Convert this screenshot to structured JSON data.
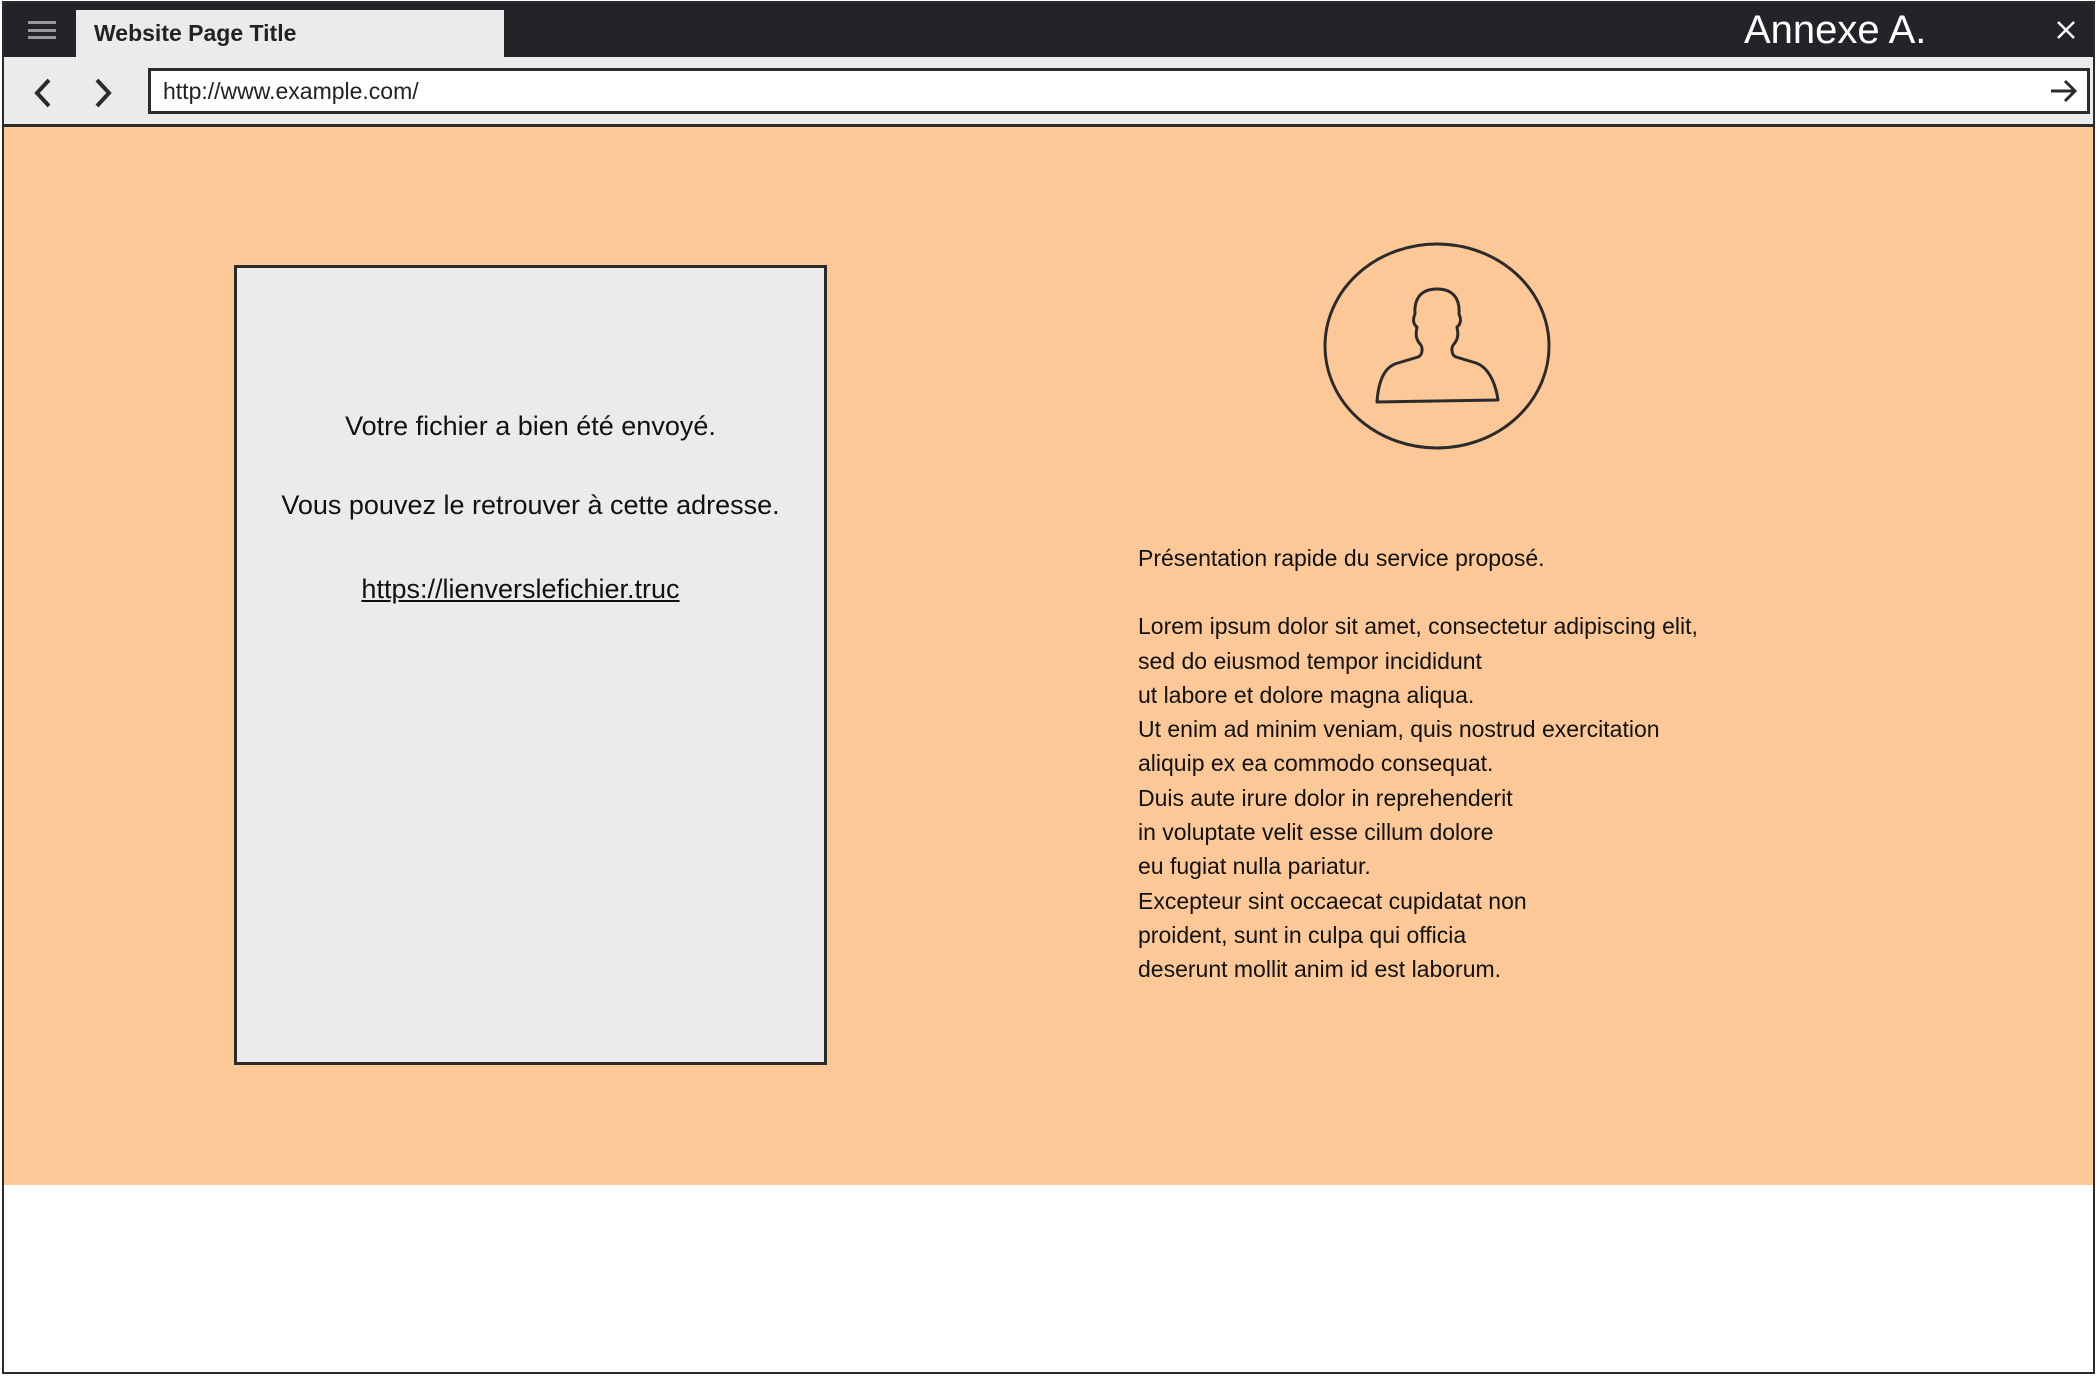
{
  "browser": {
    "tab_title": "Website Page Title",
    "annex_label": "Annexe A.",
    "url": "http://www.example.com/"
  },
  "icons": {
    "menu": "hamburger-menu-icon",
    "close": "close-icon",
    "back": "chevron-left-icon",
    "forward": "chevron-right-icon",
    "go": "arrow-right-icon",
    "avatar": "user-avatar-icon"
  },
  "colors": {
    "titlebar": "#232427",
    "content_background": "#fdc897",
    "panel_background": "#ebebeb"
  },
  "confirmation": {
    "line1": "Votre fichier a bien été envoyé.",
    "line2": "Vous pouvez le retrouver à cette adresse.",
    "link": "https://lienverslefichier.truc"
  },
  "description": {
    "intro": "Présentation rapide du service proposé.",
    "lines": [
      "Lorem ipsum dolor sit amet, consectetur adipiscing elit,",
      "sed do eiusmod tempor incididunt",
      "ut labore et dolore magna aliqua.",
      "Ut enim ad minim veniam, quis nostrud exercitation",
      "aliquip ex ea commodo consequat.",
      "Duis aute irure dolor in reprehenderit",
      "in voluptate velit esse cillum dolore",
      "eu fugiat nulla pariatur.",
      "Excepteur sint occaecat cupidatat non",
      "proident, sunt in culpa qui officia",
      "deserunt mollit anim id est laborum."
    ]
  }
}
